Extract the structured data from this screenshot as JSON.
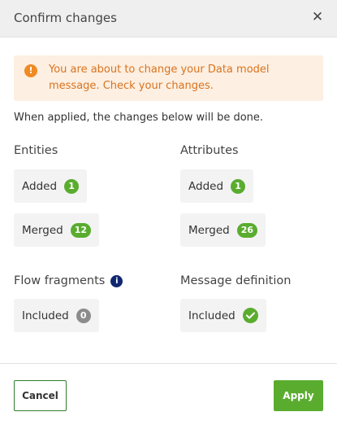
{
  "dialog": {
    "title": "Confirm changes",
    "close_icon": "close-icon"
  },
  "warning": {
    "icon": "exclamation-icon",
    "text": "You are about to change your Data model message. Check your changes.",
    "colors": {
      "background": "#fdefe1",
      "text": "#d9731f",
      "icon": "#f08a24"
    }
  },
  "intro": "When applied, the changes below will be done.",
  "entities": {
    "title": "Entities",
    "added": {
      "label": "Added",
      "count": "1"
    },
    "merged": {
      "label": "Merged",
      "count": "12"
    }
  },
  "attributes": {
    "title": "Attributes",
    "added": {
      "label": "Added",
      "count": "1"
    },
    "merged": {
      "label": "Merged",
      "count": "26"
    }
  },
  "flow_fragments": {
    "title": "Flow fragments",
    "info_icon": "info-icon",
    "included": {
      "label": "Included",
      "count": "0"
    }
  },
  "message_definition": {
    "title": "Message definition",
    "included": {
      "label": "Included",
      "icon": "checkmark-icon"
    }
  },
  "footer": {
    "cancel_label": "Cancel",
    "apply_label": "Apply"
  },
  "colors": {
    "accent_green": "#5aac2f",
    "cancel_border": "#2f7d2a",
    "zero_badge": "#8c8c8c",
    "info_navy": "#10266f"
  }
}
